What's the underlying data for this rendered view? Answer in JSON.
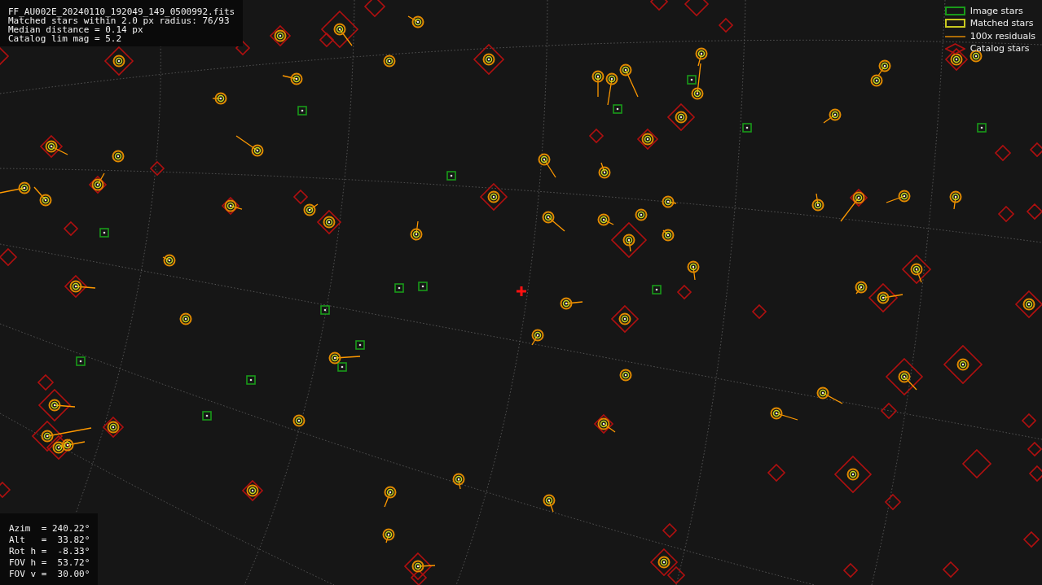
{
  "header": {
    "lines": [
      "FF_AU002E_20240110_192049_149_0500992.fits",
      "Matched stars within 2.0 px radius: 76/93",
      "Median distance = 0.14 px",
      "Catalog lim mag = 5.2"
    ]
  },
  "legend": [
    {
      "kind": "image",
      "label": "Image stars"
    },
    {
      "kind": "matched",
      "label": "Matched stars"
    },
    {
      "kind": "residual",
      "label": "100x residuals"
    },
    {
      "kind": "catalog",
      "label": "Catalog stars"
    }
  ],
  "pointing": {
    "lines": [
      "Azim  = 240.22°",
      "Alt   =  33.82°",
      "Rot h =  -8.33°",
      "FOV h =  53.72°",
      "FOV v =  30.00°"
    ]
  }
}
